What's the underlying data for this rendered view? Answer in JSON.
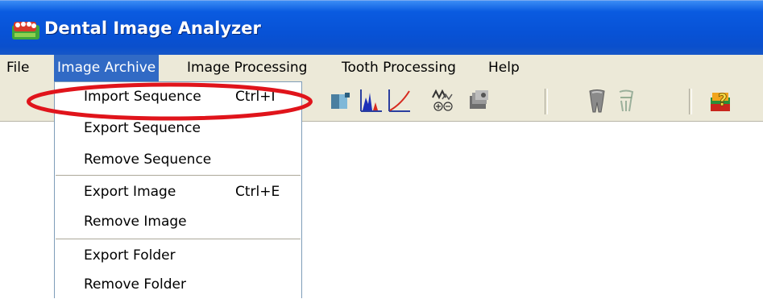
{
  "window": {
    "title": "Dental Image Analyzer",
    "icon": "app-teeth-icon"
  },
  "menubar": {
    "items": [
      {
        "label": "File",
        "active": false
      },
      {
        "label": "Image Archive",
        "active": true
      },
      {
        "label": "Image Processing",
        "active": false
      },
      {
        "label": "Tooth Processing",
        "active": false
      },
      {
        "label": "Help",
        "active": false
      }
    ]
  },
  "toolbar": {
    "icons": [
      "image-adjust-icon",
      "histogram-icon",
      "curve-icon",
      "zoom-in-out-icon",
      "camera-icon",
      "tooth-gray-icon",
      "tooth-root-icon",
      "help-question-icon"
    ]
  },
  "dropdown": {
    "items": [
      {
        "label": "Import Sequence",
        "shortcut": "Ctrl+I"
      },
      {
        "label": "Export Sequence",
        "shortcut": ""
      },
      {
        "label": "Remove Sequence",
        "shortcut": ""
      },
      {
        "label": "Export Image",
        "shortcut": "Ctrl+E"
      },
      {
        "label": "Remove Image",
        "shortcut": ""
      },
      {
        "label": "Export Folder",
        "shortcut": ""
      },
      {
        "label": "Remove Folder",
        "shortcut": ""
      }
    ]
  },
  "annotation": {
    "color": "#e0141b",
    "shape": "ellipse"
  },
  "colors": {
    "titlebar": "#0852d6",
    "menu_highlight": "#316ac5",
    "menu_bg": "#ece9d8"
  }
}
